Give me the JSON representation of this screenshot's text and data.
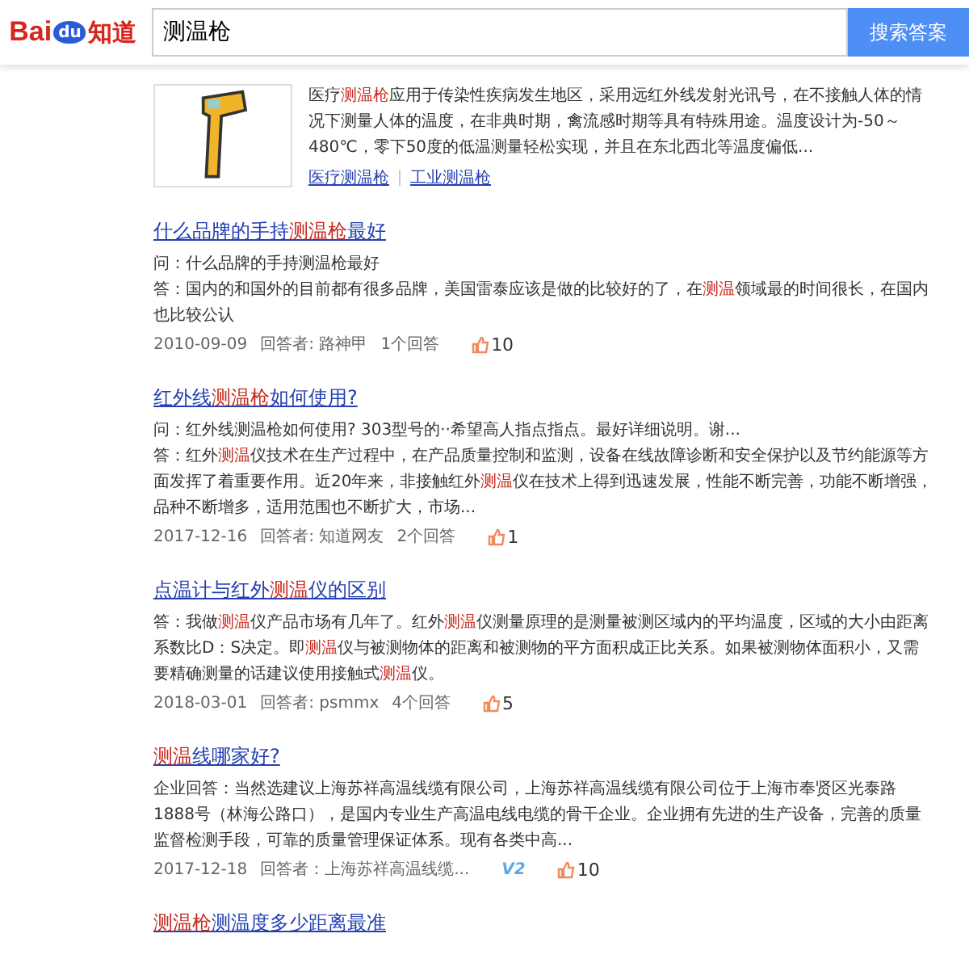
{
  "header": {
    "logo_latin": "Bai",
    "logo_paw": "du",
    "logo_cjk": "知道",
    "search_value": "测温枪",
    "search_button": "搜索答案"
  },
  "featured": {
    "snippet": [
      {
        "text": "医疗",
        "highlight": false
      },
      {
        "text": "测温枪",
        "highlight": true
      },
      {
        "text": "应用于传染性疾病发生地区，采用远红外线发射光讯号，在不接触人体的情况下测量人体的温度，在非典时期，禽流感时期等具有特殊用途。温度设计为-50～480℃，零下50度的低温测量轻松实现，并且在东北西北等温度偏低...",
        "highlight": false
      }
    ],
    "tags": [
      "医疗测温枪",
      "工业测温枪"
    ]
  },
  "results": [
    {
      "title": [
        {
          "text": "什么品牌的手持",
          "highlight": false
        },
        {
          "text": "测温枪",
          "highlight": true
        },
        {
          "text": "最好",
          "highlight": false
        }
      ],
      "lines": [
        [
          {
            "text": "问：什么品牌的手持测温枪最好",
            "highlight": false
          }
        ],
        [
          {
            "text": "答：国内的和国外的目前都有很多品牌，美国雷泰应该是做的比较好的了，在",
            "highlight": false
          },
          {
            "text": "测温",
            "highlight": true
          },
          {
            "text": "领域最的时间很长，在国内也比较公认",
            "highlight": false
          }
        ]
      ],
      "date": "2010-09-09",
      "answerer": "回答者: 路神甲",
      "answers": "1个回答",
      "likes": "10"
    },
    {
      "title": [
        {
          "text": "红外线",
          "highlight": false
        },
        {
          "text": "测温枪",
          "highlight": true
        },
        {
          "text": "如何使用?",
          "highlight": false
        }
      ],
      "lines": [
        [
          {
            "text": "问：红外线测温枪如何使用? 303型号的··希望高人指点指点。最好详细说明。谢...",
            "highlight": false
          }
        ],
        [
          {
            "text": "答：红外",
            "highlight": false
          },
          {
            "text": "测温",
            "highlight": true
          },
          {
            "text": "仪技术在生产过程中，在产品质量控制和监测，设备在线故障诊断和安全保护以及节约能源等方面发挥了着重要作用。近20年来，非接触红外",
            "highlight": false
          },
          {
            "text": "测温",
            "highlight": true
          },
          {
            "text": "仪在技术上得到迅速发展，性能不断完善，功能不断增强，品种不断增多，适用范围也不断扩大，市场...",
            "highlight": false
          }
        ]
      ],
      "date": "2017-12-16",
      "answerer": "回答者: 知道网友",
      "answers": "2个回答",
      "likes": "1"
    },
    {
      "title": [
        {
          "text": "点温计与红外",
          "highlight": false
        },
        {
          "text": "测温",
          "highlight": true
        },
        {
          "text": "仪的区别",
          "highlight": false
        }
      ],
      "lines": [
        [
          {
            "text": "答：我做",
            "highlight": false
          },
          {
            "text": "测温",
            "highlight": true
          },
          {
            "text": "仪产品市场有几年了。红外",
            "highlight": false
          },
          {
            "text": "测温",
            "highlight": true
          },
          {
            "text": "仪测量原理的是测量被测区域内的平均温度，区域的大小由距离系数比D：S决定。即",
            "highlight": false
          },
          {
            "text": "测温",
            "highlight": true
          },
          {
            "text": "仪与被测物体的距离和被测物的平方面积成正比关系。如果被测物体面积小，又需要精确测量的话建议使用接触式",
            "highlight": false
          },
          {
            "text": "测温",
            "highlight": true
          },
          {
            "text": "仪。",
            "highlight": false
          }
        ]
      ],
      "date": "2018-03-01",
      "answerer": "回答者: psmmx",
      "answers": "4个回答",
      "likes": "5"
    },
    {
      "title": [
        {
          "text": "测温",
          "highlight": true
        },
        {
          "text": "线哪家好?",
          "highlight": false
        }
      ],
      "lines": [
        [
          {
            "text": "企业回答：当然选建议上海苏祥高温线缆有限公司，上海苏祥高温线缆有限公司位于上海市奉贤区光泰路1888号（林海公路口），是国内专业生产高温电线电缆的骨干企业。企业拥有先进的生产设备，完善的质量监督检测手段，可靠的质量管理保证体系。现有各类中高...",
            "highlight": false
          }
        ]
      ],
      "date": "2017-12-18",
      "answerer": "回答者：上海苏祥高温线缆...",
      "badge": "V2",
      "likes": "10"
    },
    {
      "title": [
        {
          "text": "测温枪",
          "highlight": true
        },
        {
          "text": "测温度多少距离最准",
          "highlight": false
        }
      ]
    }
  ]
}
